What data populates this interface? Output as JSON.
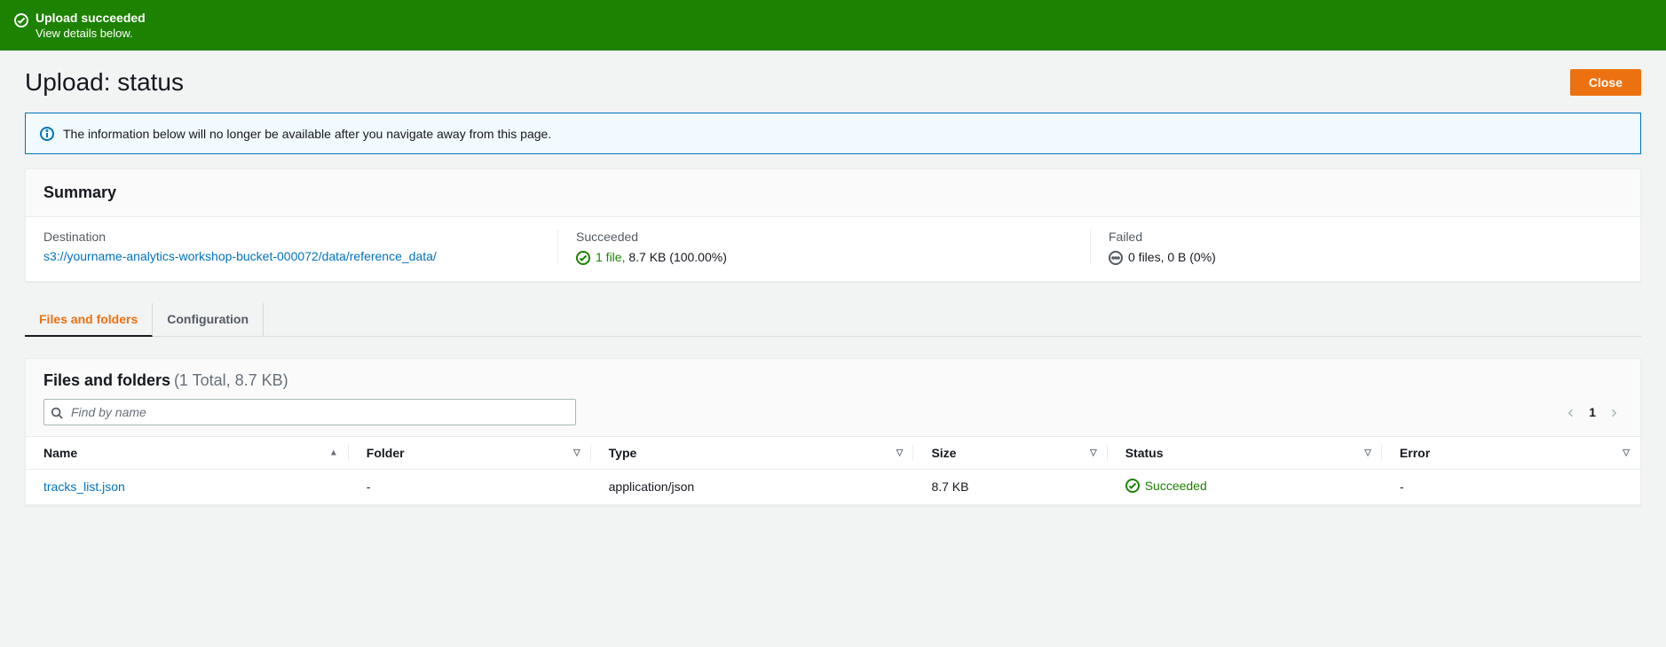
{
  "banner": {
    "title": "Upload succeeded",
    "subtitle": "View details below."
  },
  "header": {
    "page_title": "Upload: status",
    "close_button": "Close"
  },
  "info_alert": {
    "text": "The information below will no longer be available after you navigate away from this page."
  },
  "summary": {
    "title": "Summary",
    "destination_label": "Destination",
    "destination_value": "s3://yourname-analytics-workshop-bucket-000072/data/reference_data/",
    "succeeded_label": "Succeeded",
    "succeeded_prefix": "1 file,",
    "succeeded_rest": " 8.7 KB (100.00%)",
    "failed_label": "Failed",
    "failed_value": "0 files, 0 B (0%)"
  },
  "tabs": {
    "files": "Files and folders",
    "config": "Configuration"
  },
  "files": {
    "title": "Files and folders",
    "count_text": "(1 Total, 8.7 KB)",
    "search_placeholder": "Find by name",
    "page_number": "1",
    "columns": {
      "name": "Name",
      "folder": "Folder",
      "type": "Type",
      "size": "Size",
      "status": "Status",
      "error": "Error"
    },
    "row": {
      "name": "tracks_list.json",
      "folder": "-",
      "type": "application/json",
      "size": "8.7 KB",
      "status": "Succeeded",
      "error": "-"
    }
  }
}
